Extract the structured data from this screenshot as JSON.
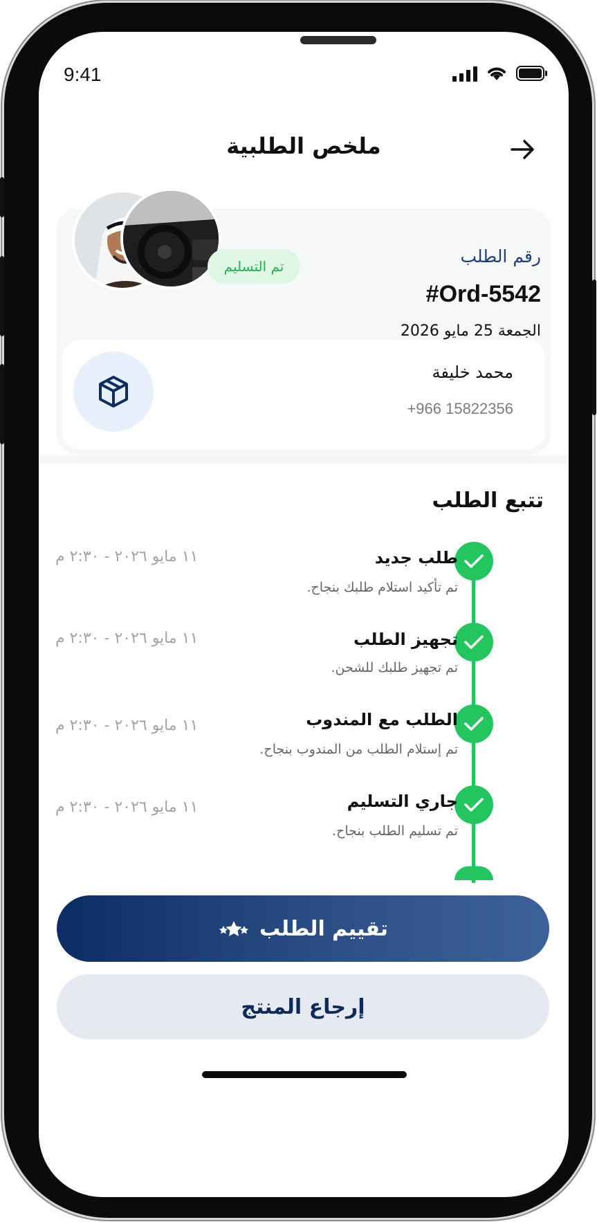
{
  "status_bar": {
    "time": "9:41"
  },
  "header": {
    "title": "ملخص الطلبية",
    "back_icon": "arrow-right-icon"
  },
  "order": {
    "label": "رقم الطلب",
    "number": "#Ord-5542",
    "date": "الجمعة 25 مايو 2026",
    "status": "تم التسليم",
    "status_color": "#22b24c"
  },
  "customer": {
    "name": "محمد خليفة",
    "phone": "+966 15822356",
    "icon": "package-icon"
  },
  "tracking": {
    "title": "تتبع الطلب",
    "steps": [
      {
        "title": "طلب جديد",
        "desc": "تم تأكيد استلام طلبك بنجاح.",
        "time": "١١ مايو ٢٠٢٦ - ٢:٣٠ م"
      },
      {
        "title": "تجهيز الطلب",
        "desc": "تم تجهيز طلبك للشحن.",
        "time": "١١ مايو ٢٠٢٦ - ٢:٣٠ م"
      },
      {
        "title": "الطلب مع المندوب",
        "desc": "تم إستلام الطلب من المندوب بنجاح.",
        "time": "١١ مايو ٢٠٢٦ - ٢:٣٠ م"
      },
      {
        "title": "جاري التسليم",
        "desc": "تم تسليم الطلب بنجاح.",
        "time": "١١ مايو ٢٠٢٦ - ٢:٣٠ م"
      }
    ],
    "accent": "#22c55e"
  },
  "actions": {
    "rate_label": "تقييم الطلب",
    "return_label": "إرجاع المنتج"
  }
}
